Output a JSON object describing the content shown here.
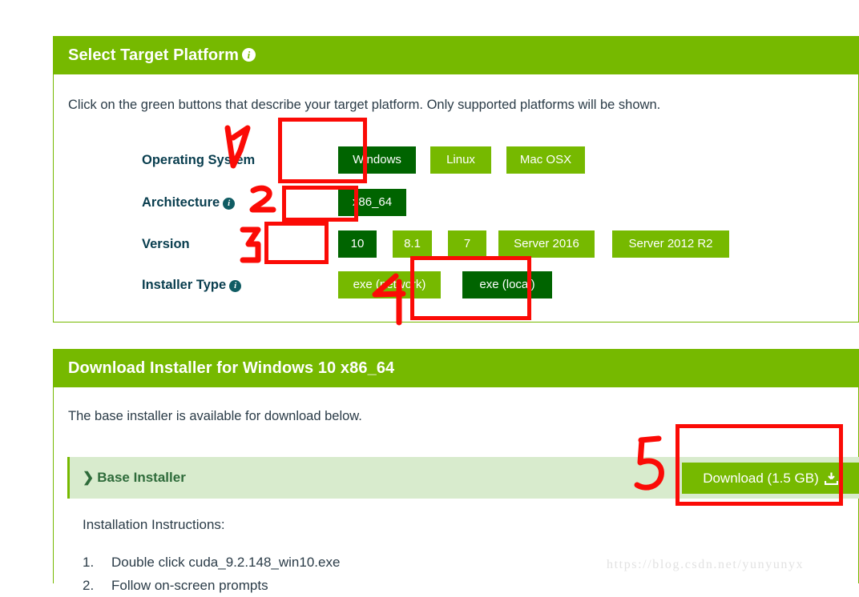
{
  "platform_panel": {
    "header_title": "Select Target Platform",
    "header_info_icon": "info-icon",
    "intro": "Click on the green buttons that describe your target platform. Only supported platforms will be shown.",
    "rows": [
      {
        "label": "Operating System",
        "has_info": false,
        "options": [
          {
            "label": "Windows",
            "selected": true
          },
          {
            "label": "Linux",
            "selected": false
          },
          {
            "label": "Mac OSX",
            "selected": false
          }
        ]
      },
      {
        "label": "Architecture",
        "has_info": true,
        "options": [
          {
            "label": "x86_64",
            "selected": true
          }
        ]
      },
      {
        "label": "Version",
        "has_info": false,
        "options": [
          {
            "label": "10",
            "selected": true
          },
          {
            "label": "8.1",
            "selected": false
          },
          {
            "label": "7",
            "selected": false
          },
          {
            "label": "Server 2016",
            "selected": false
          },
          {
            "label": "Server 2012 R2",
            "selected": false
          }
        ]
      },
      {
        "label": "Installer Type",
        "has_info": true,
        "options": [
          {
            "label": "exe (network)",
            "selected": false
          },
          {
            "label": "exe (local)",
            "selected": true
          }
        ]
      }
    ]
  },
  "download_panel": {
    "header_title": "Download Installer for Windows 10 x86_64",
    "intro": "The base installer is available for download below.",
    "installer_title": "Base Installer",
    "chevron": "❯",
    "download_label": "Download (1.5 GB)",
    "download_icon": "download-icon",
    "instructions_title": "Installation Instructions:",
    "instructions": [
      {
        "num": "1.",
        "text": "Double click cuda_9.2.148_win10.exe"
      },
      {
        "num": "2.",
        "text": "Follow on-screen prompts"
      }
    ]
  },
  "annotations": {
    "numbers": [
      "1",
      "2",
      "3",
      "4",
      "5"
    ],
    "color": "#fb0b06"
  },
  "watermark": "https://blog.csdn.net/yunyunyx",
  "colors": {
    "brand_green": "#76b900",
    "selected_green": "#006400",
    "light_green_bar": "#d8ebcd",
    "annotation_red": "#fb0b06",
    "text": "#2a3b47"
  }
}
